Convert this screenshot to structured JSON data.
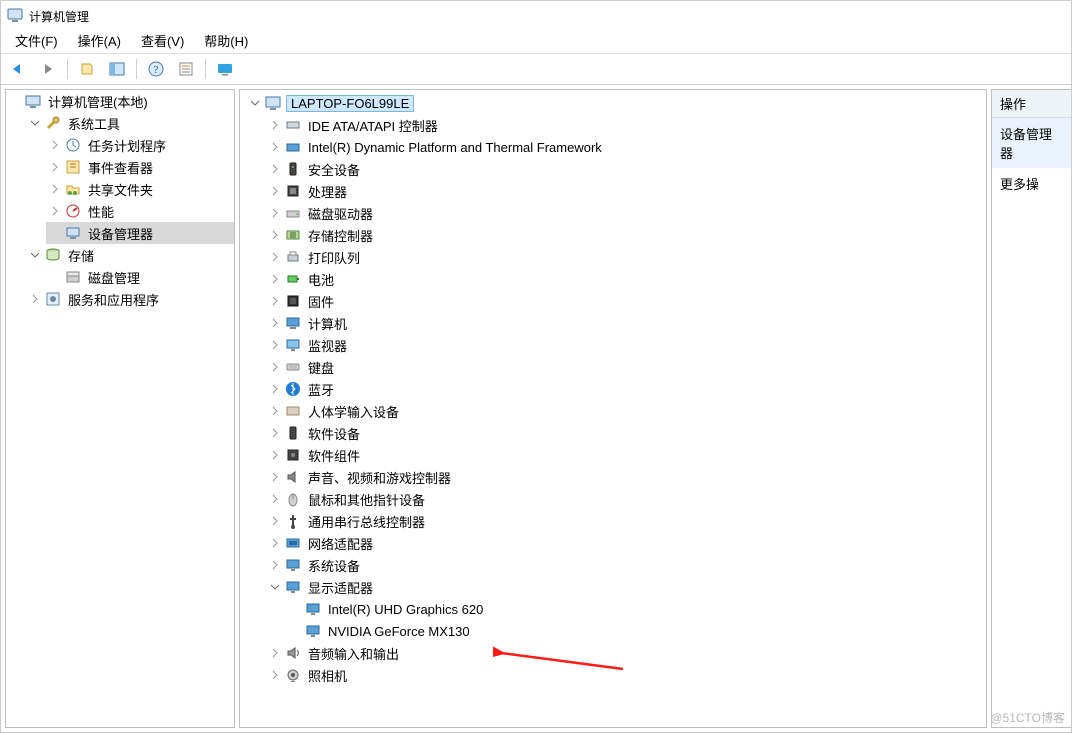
{
  "title": "计算机管理",
  "menu": {
    "file": "文件(F)",
    "action": "操作(A)",
    "view": "查看(V)",
    "help": "帮助(H)"
  },
  "left_tree": {
    "root": "计算机管理(本地)",
    "system_tools": "系统工具",
    "task_scheduler": "任务计划程序",
    "event_viewer": "事件查看器",
    "shared_folders": "共享文件夹",
    "performance": "性能",
    "device_manager": "设备管理器",
    "storage": "存储",
    "disk_management": "磁盘管理",
    "services_apps": "服务和应用程序"
  },
  "center_tree": {
    "root": "LAPTOP-FO6L99LE",
    "ide": "IDE ATA/ATAPI 控制器",
    "intel_dptf": "Intel(R) Dynamic Platform and Thermal Framework",
    "security": "安全设备",
    "cpu": "处理器",
    "disk_drives": "磁盘驱动器",
    "storage_ctrl": "存储控制器",
    "print_queue": "打印队列",
    "battery": "电池",
    "firmware": "固件",
    "computer": "计算机",
    "monitor": "监视器",
    "keyboard": "键盘",
    "bluetooth": "蓝牙",
    "hid": "人体学输入设备",
    "sw_devices": "软件设备",
    "sw_components": "软件组件",
    "sound": "声音、视频和游戏控制器",
    "mouse": "鼠标和其他指针设备",
    "usb": "通用串行总线控制器",
    "network": "网络适配器",
    "system_devices": "系统设备",
    "display": "显示适配器",
    "display_uhd": "Intel(R) UHD Graphics 620",
    "display_nvidia": "NVIDIA GeForce MX130",
    "audio_io": "音频输入和输出",
    "camera": "照相机"
  },
  "right": {
    "header": "操作",
    "item1": "设备管理器",
    "item2": "更多操"
  },
  "watermark": "@51CTO博客"
}
